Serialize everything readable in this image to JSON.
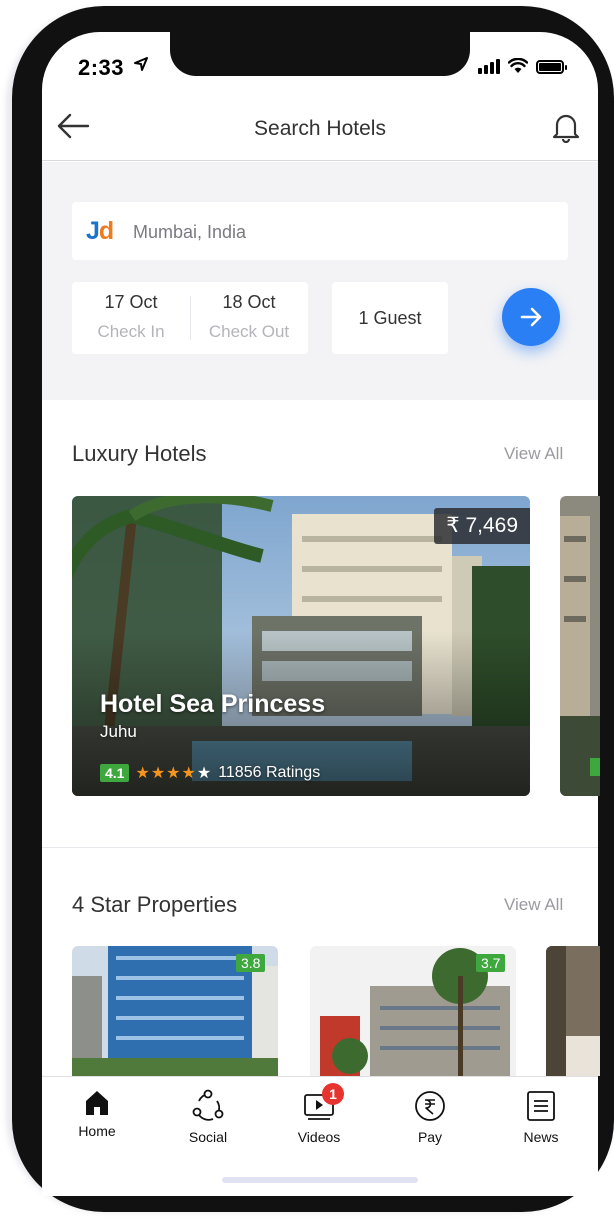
{
  "status_bar": {
    "time": "2:33"
  },
  "header": {
    "title": "Search Hotels",
    "back_icon": "arrow-left-icon",
    "notification_icon": "bell-icon"
  },
  "search": {
    "logo_j": "J",
    "logo_d": "d",
    "location": "Mumbai, India",
    "check_in": {
      "date": "17 Oct",
      "label": "Check In"
    },
    "check_out": {
      "date": "18 Oct",
      "label": "Check Out"
    },
    "guests": "1 Guest",
    "go_icon": "arrow-right-icon",
    "accent_color": "#2a7ff5"
  },
  "luxury": {
    "title": "Luxury Hotels",
    "view_all": "View All",
    "hotels": [
      {
        "name": "Hotel Sea Princess",
        "area": "Juhu",
        "price": "₹ 7,469",
        "rating": "4.1",
        "stars": 4,
        "ratings_count": "11856 Ratings"
      }
    ]
  },
  "four_star": {
    "title": "4 Star Properties",
    "view_all": "View All",
    "properties": [
      {
        "rating": "3.8"
      },
      {
        "rating": "3.7"
      }
    ]
  },
  "bottom_nav": {
    "items": [
      {
        "label": "Home",
        "icon": "home-icon"
      },
      {
        "label": "Social",
        "icon": "social-icon"
      },
      {
        "label": "Videos",
        "icon": "videos-icon",
        "badge": "1"
      },
      {
        "label": "Pay",
        "icon": "rupee-icon"
      },
      {
        "label": "News",
        "icon": "news-icon"
      }
    ]
  },
  "colors": {
    "rating_green": "#3ea83e",
    "star_orange": "#f7941d",
    "badge_red": "#e8342e"
  }
}
